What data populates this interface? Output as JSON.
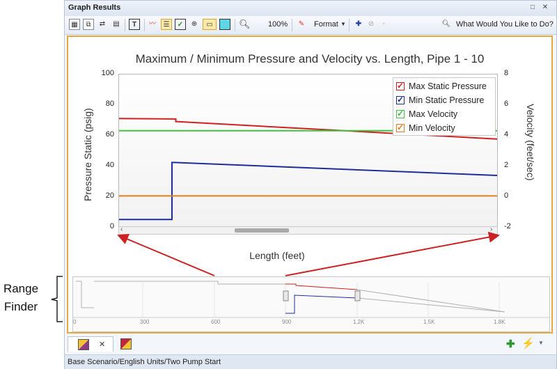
{
  "window": {
    "title": "Graph Results",
    "title_buttons": [
      "□",
      "✕"
    ]
  },
  "toolbar": {
    "zoom_label": "100%",
    "format_label": "Format",
    "help_label": "What Would You Like to Do?"
  },
  "chart_data": {
    "type": "line",
    "title": "Maximum / Minimum Pressure and Velocity vs. Length, Pipe 1 - 10",
    "xlabel": "Length (feet)",
    "ylabel": "Pressure Static (psig)",
    "y2label": "Velocity (feet/sec)",
    "ylim": [
      0,
      100
    ],
    "y2lim": [
      -2,
      8
    ],
    "yticks": [
      "100",
      "80",
      "60",
      "40",
      "20",
      "0"
    ],
    "y2ticks": [
      "8",
      "6",
      "4",
      "2",
      "0",
      "-2"
    ],
    "xlim": [
      600,
      900
    ],
    "grid": false,
    "legend_position": "top-right",
    "series": [
      {
        "name": "Max Static Pressure",
        "axis": "left",
        "color": "#d02020",
        "x": [
          600,
          645,
          645,
          900
        ],
        "y": [
          71,
          70.7,
          69,
          57.5
        ]
      },
      {
        "name": "Min Static Pressure",
        "axis": "left",
        "color": "#1e2d9c",
        "x": [
          600,
          642,
          642,
          645,
          900
        ],
        "y": [
          4.5,
          4.5,
          42,
          42,
          33.5
        ]
      },
      {
        "name": "Max Velocity",
        "axis": "right",
        "color": "#3cc43c",
        "x": [
          600,
          900
        ],
        "y": [
          4.3,
          4.3
        ]
      },
      {
        "name": "Min Velocity",
        "axis": "right",
        "color": "#e07f20",
        "x": [
          600,
          900
        ],
        "y": [
          0,
          0
        ]
      }
    ]
  },
  "range_finder": {
    "label": "Range Finder",
    "ticks": [
      "0",
      "300",
      "600",
      "900",
      "1.2K",
      "1.5K",
      "1.8K"
    ]
  },
  "tabs": [
    {
      "close": "✕"
    }
  ],
  "status_bar": "Base Scenario/English Units/Two Pump Start",
  "colors": {
    "panel_border": "#e7a93b",
    "arrow": "#cc2222"
  }
}
